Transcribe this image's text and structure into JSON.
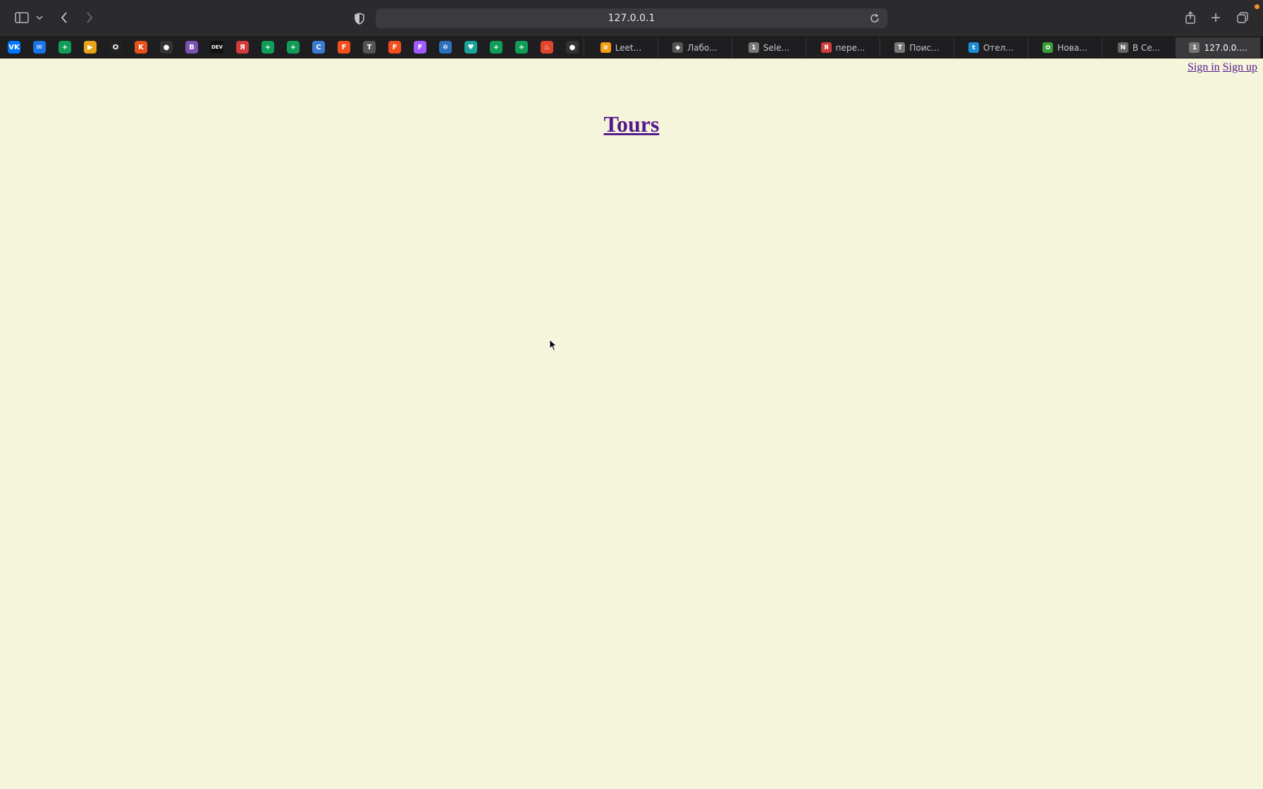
{
  "browser": {
    "address": "127.0.0.1",
    "pinned_tabs": [
      {
        "icon": "vk-icon",
        "glyph": "VK",
        "color": "#0077ff"
      },
      {
        "icon": "mail-icon",
        "glyph": "✉",
        "color": "#1a73e8"
      },
      {
        "icon": "sheets-icon",
        "glyph": "+",
        "color": "#0f9d58"
      },
      {
        "icon": "video-player-icon",
        "glyph": "▶",
        "color": "#e8a317"
      },
      {
        "icon": "opera-icon",
        "glyph": "O",
        "color": "#222222"
      },
      {
        "icon": "app-icon",
        "glyph": "K",
        "color": "#e8501c"
      },
      {
        "icon": "github-icon",
        "glyph": "●",
        "color": "#333333"
      },
      {
        "icon": "bootstrap-icon",
        "glyph": "B",
        "color": "#7952b3"
      },
      {
        "icon": "dev-icon",
        "glyph": "DEV",
        "color": "#111111"
      },
      {
        "icon": "yandex-icon",
        "glyph": "Я",
        "color": "#d33b3b"
      },
      {
        "icon": "sheets-icon",
        "glyph": "+",
        "color": "#0f9d58"
      },
      {
        "icon": "sheets-icon",
        "glyph": "+",
        "color": "#0f9d58"
      },
      {
        "icon": "c-icon",
        "glyph": "C",
        "color": "#3a7bd5"
      },
      {
        "icon": "figma-icon",
        "glyph": "F",
        "color": "#f24e1e"
      },
      {
        "icon": "typora-icon",
        "glyph": "T",
        "color": "#555555"
      },
      {
        "icon": "figma-icon",
        "glyph": "F",
        "color": "#f24e1e"
      },
      {
        "icon": "figma-icon",
        "glyph": "F",
        "color": "#a259ff"
      },
      {
        "icon": "network-icon",
        "glyph": "✲",
        "color": "#2c6fbb"
      },
      {
        "icon": "shield-icon",
        "glyph": "♥",
        "color": "#1aa39a"
      },
      {
        "icon": "sheets-icon",
        "glyph": "+",
        "color": "#0f9d58"
      },
      {
        "icon": "sheets-icon",
        "glyph": "+",
        "color": "#0f9d58"
      },
      {
        "icon": "fire-icon",
        "glyph": "♨",
        "color": "#e0452b"
      },
      {
        "icon": "github-icon",
        "glyph": "●",
        "color": "#333333"
      }
    ],
    "tabs": [
      {
        "label": "Leet...",
        "fav": "≡",
        "color": "#f39c12"
      },
      {
        "label": "Лабо...",
        "fav": "◆",
        "color": "#555555"
      },
      {
        "label": "Sele...",
        "fav": "1",
        "color": "#777777"
      },
      {
        "label": "пере...",
        "fav": "Я",
        "color": "#d33b3b"
      },
      {
        "label": "Поис...",
        "fav": "T",
        "color": "#777777"
      },
      {
        "label": "Отел...",
        "fav": "t",
        "color": "#1b8dd6"
      },
      {
        "label": "Нова...",
        "fav": "✿",
        "color": "#3a9d3a"
      },
      {
        "label": "В Се...",
        "fav": "N",
        "color": "#666666"
      },
      {
        "label": "127.0.0....",
        "fav": "1",
        "color": "#777777",
        "active": true
      }
    ]
  },
  "page": {
    "sign_in": "Sign in",
    "sign_up": "Sign up",
    "heading": "Tours"
  },
  "colors": {
    "page_background": "#f5f5dc",
    "visited_link": "#551a8b"
  }
}
